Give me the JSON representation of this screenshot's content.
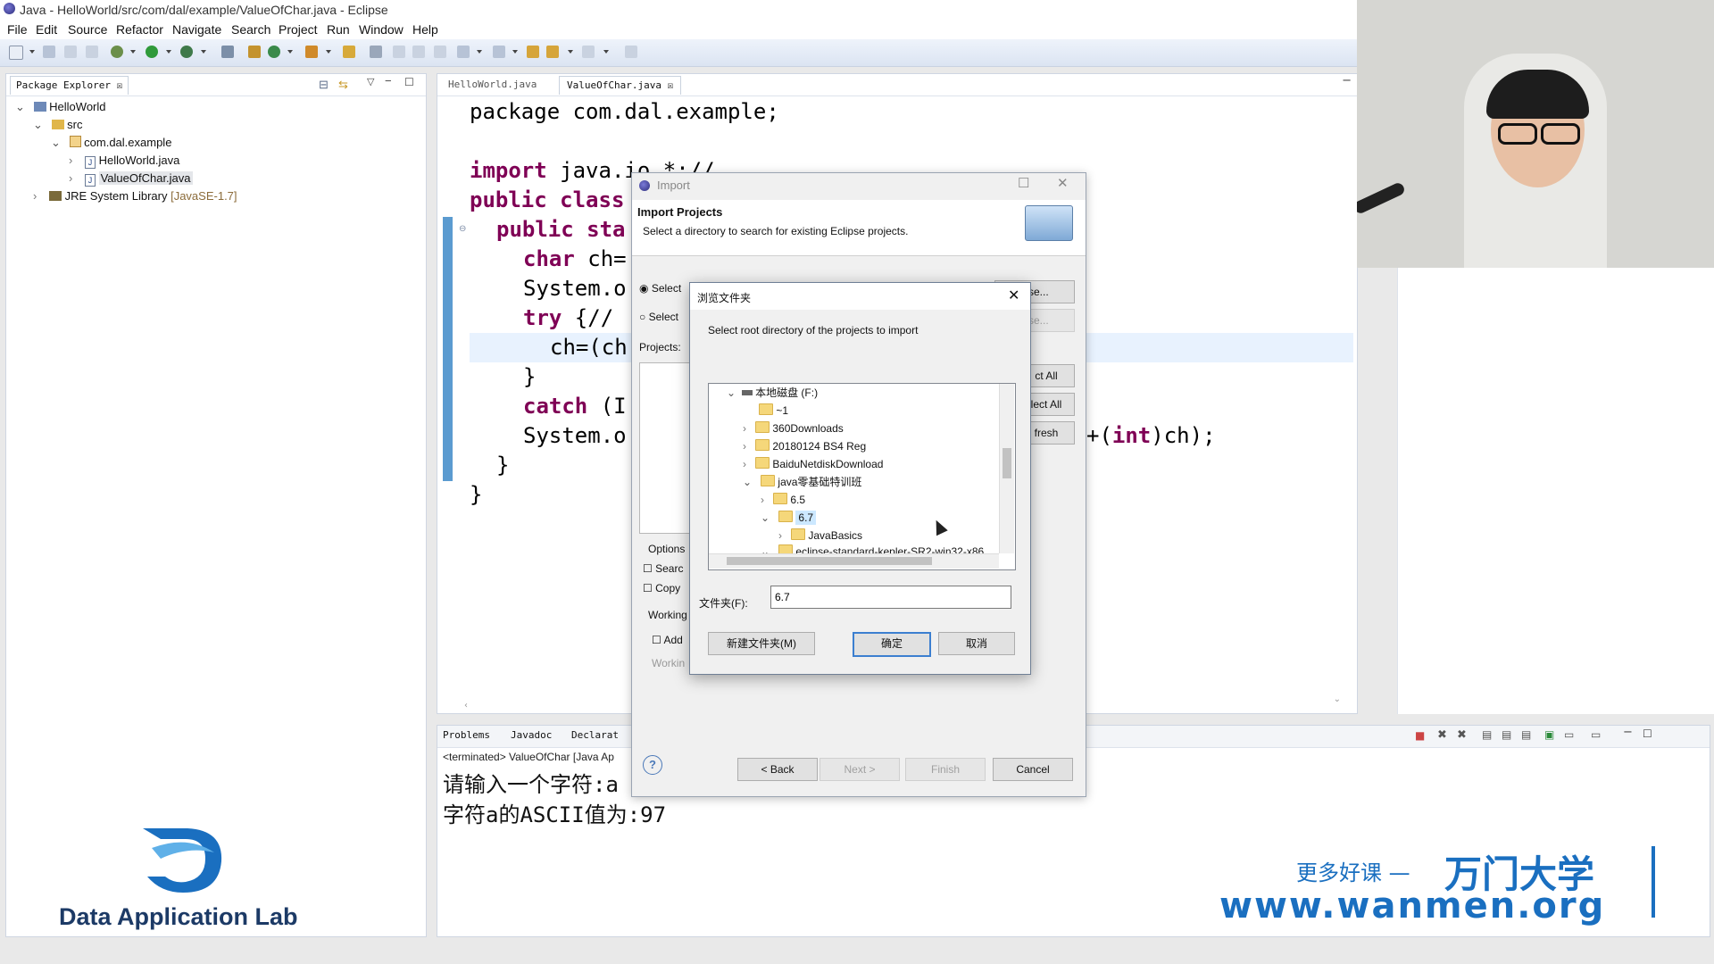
{
  "window": {
    "title": "Java - HelloWorld/src/com/dal/example/ValueOfChar.java - Eclipse"
  },
  "menu": [
    "File",
    "Edit",
    "Source",
    "Refactor",
    "Navigate",
    "Search",
    "Project",
    "Run",
    "Window",
    "Help"
  ],
  "package_explorer": {
    "tab_label": "Package Explorer ☒",
    "project": "HelloWorld",
    "src": "src",
    "package": "com.dal.example",
    "files": [
      "HelloWorld.java",
      "ValueOfChar.java"
    ],
    "jre": "JRE System Library",
    "jre_version": "[JavaSE-1.7]"
  },
  "editor": {
    "tabs": [
      "HelloWorld.java",
      "ValueOfChar.java ☒"
    ],
    "lines": {
      "l1": "package com.dal.example;",
      "l3_kw": "import",
      "l3_rest": " java.io.*;//",
      "l4_kw": "public class",
      "l4_rest": "",
      "l5_kw": "public sta",
      "l5_rest": "",
      "l6_kw": "char",
      "l6_rest": " ch=",
      "l7": "System.o",
      "l8_kw": "try",
      "l8_rest": " {//",
      "l9": "ch=(ch",
      "l10": "}",
      "l11_kw": "catch",
      "l11_rest": " (I",
      "l12": "System.o",
      "l12_tail_kw": "int",
      "l12_tail": "+(",
      "l12_tail2": ")ch);",
      "l13": "}",
      "l14": "}"
    }
  },
  "console": {
    "tabs": [
      "Problems",
      "Javadoc",
      "Declarat"
    ],
    "status": "<terminated> ValueOfChar [Java Ap",
    "output_line1": "请输入一个字符:a",
    "output_line2": "字符a的ASCII值为:97"
  },
  "import_dialog": {
    "title": "Import",
    "heading": "Import Projects",
    "description": "Select a directory to search for existing Eclipse projects.",
    "radio_root": "Select",
    "radio_archive": "Select",
    "browse1": "wse...",
    "browse2": "wse...",
    "projects_label": "Projects:",
    "select_all": "ct All",
    "deselect_all": "lect All",
    "refresh": "fresh",
    "options_label": "Options",
    "opt_search": "Searc",
    "opt_copy": "Copy",
    "working_label": "Working",
    "working_add": "Add",
    "working_sets": "Workin",
    "back": "< Back",
    "next": "Next >",
    "finish": "Finish",
    "cancel": "Cancel"
  },
  "browse_dialog": {
    "title": "浏览文件夹",
    "prompt": "Select root directory of the projects to import",
    "tree": [
      {
        "label": "本地磁盘 (F:)",
        "depth": 0,
        "expanded": true
      },
      {
        "label": "~1",
        "depth": 1
      },
      {
        "label": "360Downloads",
        "depth": 1
      },
      {
        "label": "20180124 BS4 Reg",
        "depth": 1
      },
      {
        "label": "BaiduNetdiskDownload",
        "depth": 1
      },
      {
        "label": "java零基础特训班",
        "depth": 1,
        "expanded": true
      },
      {
        "label": "6.5",
        "depth": 2
      },
      {
        "label": "6.7",
        "depth": 2,
        "expanded": true,
        "selected": true
      },
      {
        "label": "JavaBasics",
        "depth": 3
      },
      {
        "label": "eclipse-standard-kepler-SR2-win32-x86",
        "depth": 2
      }
    ],
    "folder_label": "文件夹(F):",
    "folder_value": "6.7",
    "new_folder": "新建文件夹(M)",
    "ok": "确定",
    "cancel": "取消"
  },
  "logos": {
    "dal": "Data Application Lab",
    "wanmen_cn": "更多好课 —",
    "wanmen_brand": "万门大学",
    "wanmen_url": "www.wanmen.org"
  },
  "colors": {
    "keyword": "#7f0055",
    "comment": "#3f7f5f",
    "jre_version": "#8b6b3a",
    "wanmen_blue": "#1a6fc0"
  }
}
